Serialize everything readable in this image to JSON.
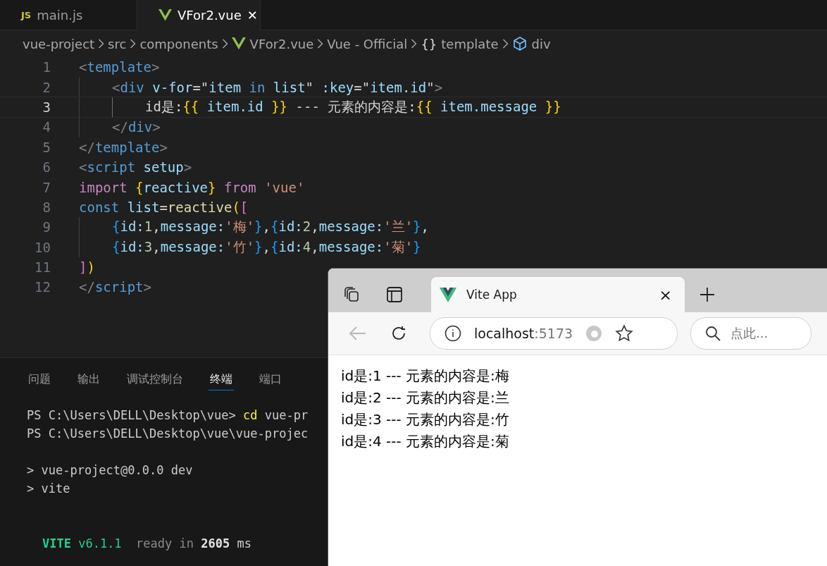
{
  "editor": {
    "tabs": [
      {
        "label": "main.js",
        "kind": "js",
        "icon_text": "JS",
        "selected": false
      },
      {
        "label": "VFor2.vue",
        "kind": "vue",
        "close": "✕",
        "selected": true
      }
    ],
    "breadcrumb": [
      {
        "label": "vue-project",
        "kind": "plain"
      },
      {
        "label": "src",
        "kind": "plain"
      },
      {
        "label": "components",
        "kind": "plain"
      },
      {
        "label": "VFor2.vue",
        "kind": "vue"
      },
      {
        "label": "Vue - Official",
        "kind": "plain"
      },
      {
        "label": "template",
        "kind": "braces",
        "glyph": "{}"
      },
      {
        "label": "div",
        "kind": "cube"
      }
    ],
    "lines": [
      {
        "number": "1",
        "current": false,
        "tokens": [
          {
            "text": "<",
            "kind": "punct"
          },
          {
            "text": "template",
            "kind": "tag"
          },
          {
            "text": ">",
            "kind": "punct"
          }
        ]
      },
      {
        "number": "2",
        "current": false,
        "tokens": [
          {
            "text": "    <",
            "kind": "punct"
          },
          {
            "text": "div",
            "kind": "tag"
          },
          {
            "text": " v-for",
            "kind": "attr"
          },
          {
            "text": "=\"",
            "kind": "text"
          },
          {
            "text": "item ",
            "kind": "var"
          },
          {
            "text": "in",
            "kind": "kw"
          },
          {
            "text": " list",
            "kind": "var"
          },
          {
            "text": "\"",
            "kind": "text"
          },
          {
            "text": " :key",
            "kind": "attr"
          },
          {
            "text": "=\"",
            "kind": "text"
          },
          {
            "text": "item.id",
            "kind": "var"
          },
          {
            "text": "\"",
            "kind": "text"
          },
          {
            "text": ">",
            "kind": "punct"
          }
        ]
      },
      {
        "number": "3",
        "current": true,
        "tokens": [
          {
            "text": "        id是:",
            "kind": "text"
          },
          {
            "text": "{{",
            "kind": "brace"
          },
          {
            "text": " item.id ",
            "kind": "var"
          },
          {
            "text": "}}",
            "kind": "brace"
          },
          {
            "text": " --- 元素的内容是:",
            "kind": "text"
          },
          {
            "text": "{{",
            "kind": "brace"
          },
          {
            "text": " item.message ",
            "kind": "var"
          },
          {
            "text": "}}",
            "kind": "brace"
          }
        ]
      },
      {
        "number": "4",
        "current": false,
        "tokens": [
          {
            "text": "    </",
            "kind": "punct"
          },
          {
            "text": "div",
            "kind": "tag"
          },
          {
            "text": ">",
            "kind": "punct"
          }
        ]
      },
      {
        "number": "5",
        "current": false,
        "tokens": [
          {
            "text": "</",
            "kind": "punct"
          },
          {
            "text": "template",
            "kind": "tag"
          },
          {
            "text": ">",
            "kind": "punct"
          }
        ]
      },
      {
        "number": "6",
        "current": false,
        "tokens": [
          {
            "text": "<",
            "kind": "punct"
          },
          {
            "text": "script",
            "kind": "tag"
          },
          {
            "text": " setup",
            "kind": "attr"
          },
          {
            "text": ">",
            "kind": "punct"
          }
        ]
      },
      {
        "number": "7",
        "current": false,
        "tokens": [
          {
            "text": "import ",
            "kind": "control"
          },
          {
            "text": "{",
            "kind": "brace"
          },
          {
            "text": "reactive",
            "kind": "var"
          },
          {
            "text": "}",
            "kind": "brace"
          },
          {
            "text": " from ",
            "kind": "control"
          },
          {
            "text": "'vue'",
            "kind": "string"
          }
        ]
      },
      {
        "number": "8",
        "current": false,
        "tokens": [
          {
            "text": "const ",
            "kind": "kw"
          },
          {
            "text": "list",
            "kind": "var"
          },
          {
            "text": "=",
            "kind": "text"
          },
          {
            "text": "reactive",
            "kind": "func"
          },
          {
            "text": "(",
            "kind": "brace"
          },
          {
            "text": "[",
            "kind": "bracket"
          }
        ]
      },
      {
        "number": "9",
        "current": false,
        "tokens": [
          {
            "text": "    {",
            "kind": "curly"
          },
          {
            "text": "id:",
            "kind": "var"
          },
          {
            "text": "1",
            "kind": "number"
          },
          {
            "text": ",",
            "kind": "text"
          },
          {
            "text": "message:",
            "kind": "var"
          },
          {
            "text": "'梅'",
            "kind": "string"
          },
          {
            "text": "}",
            "kind": "curly"
          },
          {
            "text": ",",
            "kind": "text"
          },
          {
            "text": "{",
            "kind": "curly"
          },
          {
            "text": "id:",
            "kind": "var"
          },
          {
            "text": "2",
            "kind": "number"
          },
          {
            "text": ",",
            "kind": "text"
          },
          {
            "text": "message:",
            "kind": "var"
          },
          {
            "text": "'兰'",
            "kind": "string"
          },
          {
            "text": "}",
            "kind": "curly"
          },
          {
            "text": ",",
            "kind": "text"
          }
        ]
      },
      {
        "number": "10",
        "current": false,
        "tokens": [
          {
            "text": "    {",
            "kind": "curly"
          },
          {
            "text": "id:",
            "kind": "var"
          },
          {
            "text": "3",
            "kind": "number"
          },
          {
            "text": ",",
            "kind": "text"
          },
          {
            "text": "message:",
            "kind": "var"
          },
          {
            "text": "'竹'",
            "kind": "string"
          },
          {
            "text": "}",
            "kind": "curly"
          },
          {
            "text": ",",
            "kind": "text"
          },
          {
            "text": "{",
            "kind": "curly"
          },
          {
            "text": "id:",
            "kind": "var"
          },
          {
            "text": "4",
            "kind": "number"
          },
          {
            "text": ",",
            "kind": "text"
          },
          {
            "text": "message:",
            "kind": "var"
          },
          {
            "text": "'菊'",
            "kind": "string"
          },
          {
            "text": "}",
            "kind": "curly"
          }
        ]
      },
      {
        "number": "11",
        "current": false,
        "tokens": [
          {
            "text": "]",
            "kind": "bracket"
          },
          {
            "text": ")",
            "kind": "brace"
          }
        ]
      },
      {
        "number": "12",
        "current": false,
        "tokens": [
          {
            "text": "</",
            "kind": "punct"
          },
          {
            "text": "script",
            "kind": "tag"
          },
          {
            "text": ">",
            "kind": "punct"
          }
        ]
      }
    ]
  },
  "panel": {
    "tabs": [
      {
        "label": "问题",
        "selected": false
      },
      {
        "label": "输出",
        "selected": false
      },
      {
        "label": "调试控制台",
        "selected": false
      },
      {
        "label": "终端",
        "selected": true
      },
      {
        "label": "端口",
        "selected": false
      }
    ],
    "terminal": [
      {
        "kind": "command",
        "tokens": [
          {
            "text": "PS C:\\Users\\DELL\\Desktop\\vue> ",
            "kind": "plain"
          },
          {
            "text": "cd",
            "kind": "cmd"
          },
          {
            "text": " vue-pr",
            "kind": "plain"
          }
        ]
      },
      {
        "kind": "command",
        "tokens": [
          {
            "text": "PS C:\\Users\\DELL\\Desktop\\vue\\vue-projec",
            "kind": "plain"
          }
        ]
      },
      {
        "kind": "blank"
      },
      {
        "kind": "command",
        "tokens": [
          {
            "text": "> vue-project@0.0.0 dev",
            "kind": "plain"
          }
        ]
      },
      {
        "kind": "command",
        "tokens": [
          {
            "text": "> vite",
            "kind": "plain"
          }
        ]
      },
      {
        "kind": "blank"
      },
      {
        "kind": "blank"
      },
      {
        "kind": "banner",
        "tokens": [
          {
            "text": "VITE",
            "kind": "brand"
          },
          {
            "text": " v6.1.1",
            "kind": "version"
          },
          {
            "text": "  ready in ",
            "kind": "dim"
          },
          {
            "text": "2605",
            "kind": "bold"
          },
          {
            "text": " ms",
            "kind": "plain"
          }
        ]
      }
    ]
  },
  "browser": {
    "tab": {
      "title": "Vite App",
      "close": "×"
    },
    "address": {
      "host": "localhost",
      "port": ":5173"
    },
    "search": {
      "placeholder": "点此..."
    },
    "content": [
      "id是:1 --- 元素的内容是:梅",
      "id是:2 --- 元素的内容是:兰",
      "id是:3 --- 元素的内容是:竹",
      "id是:4 --- 元素的内容是:菊"
    ]
  }
}
